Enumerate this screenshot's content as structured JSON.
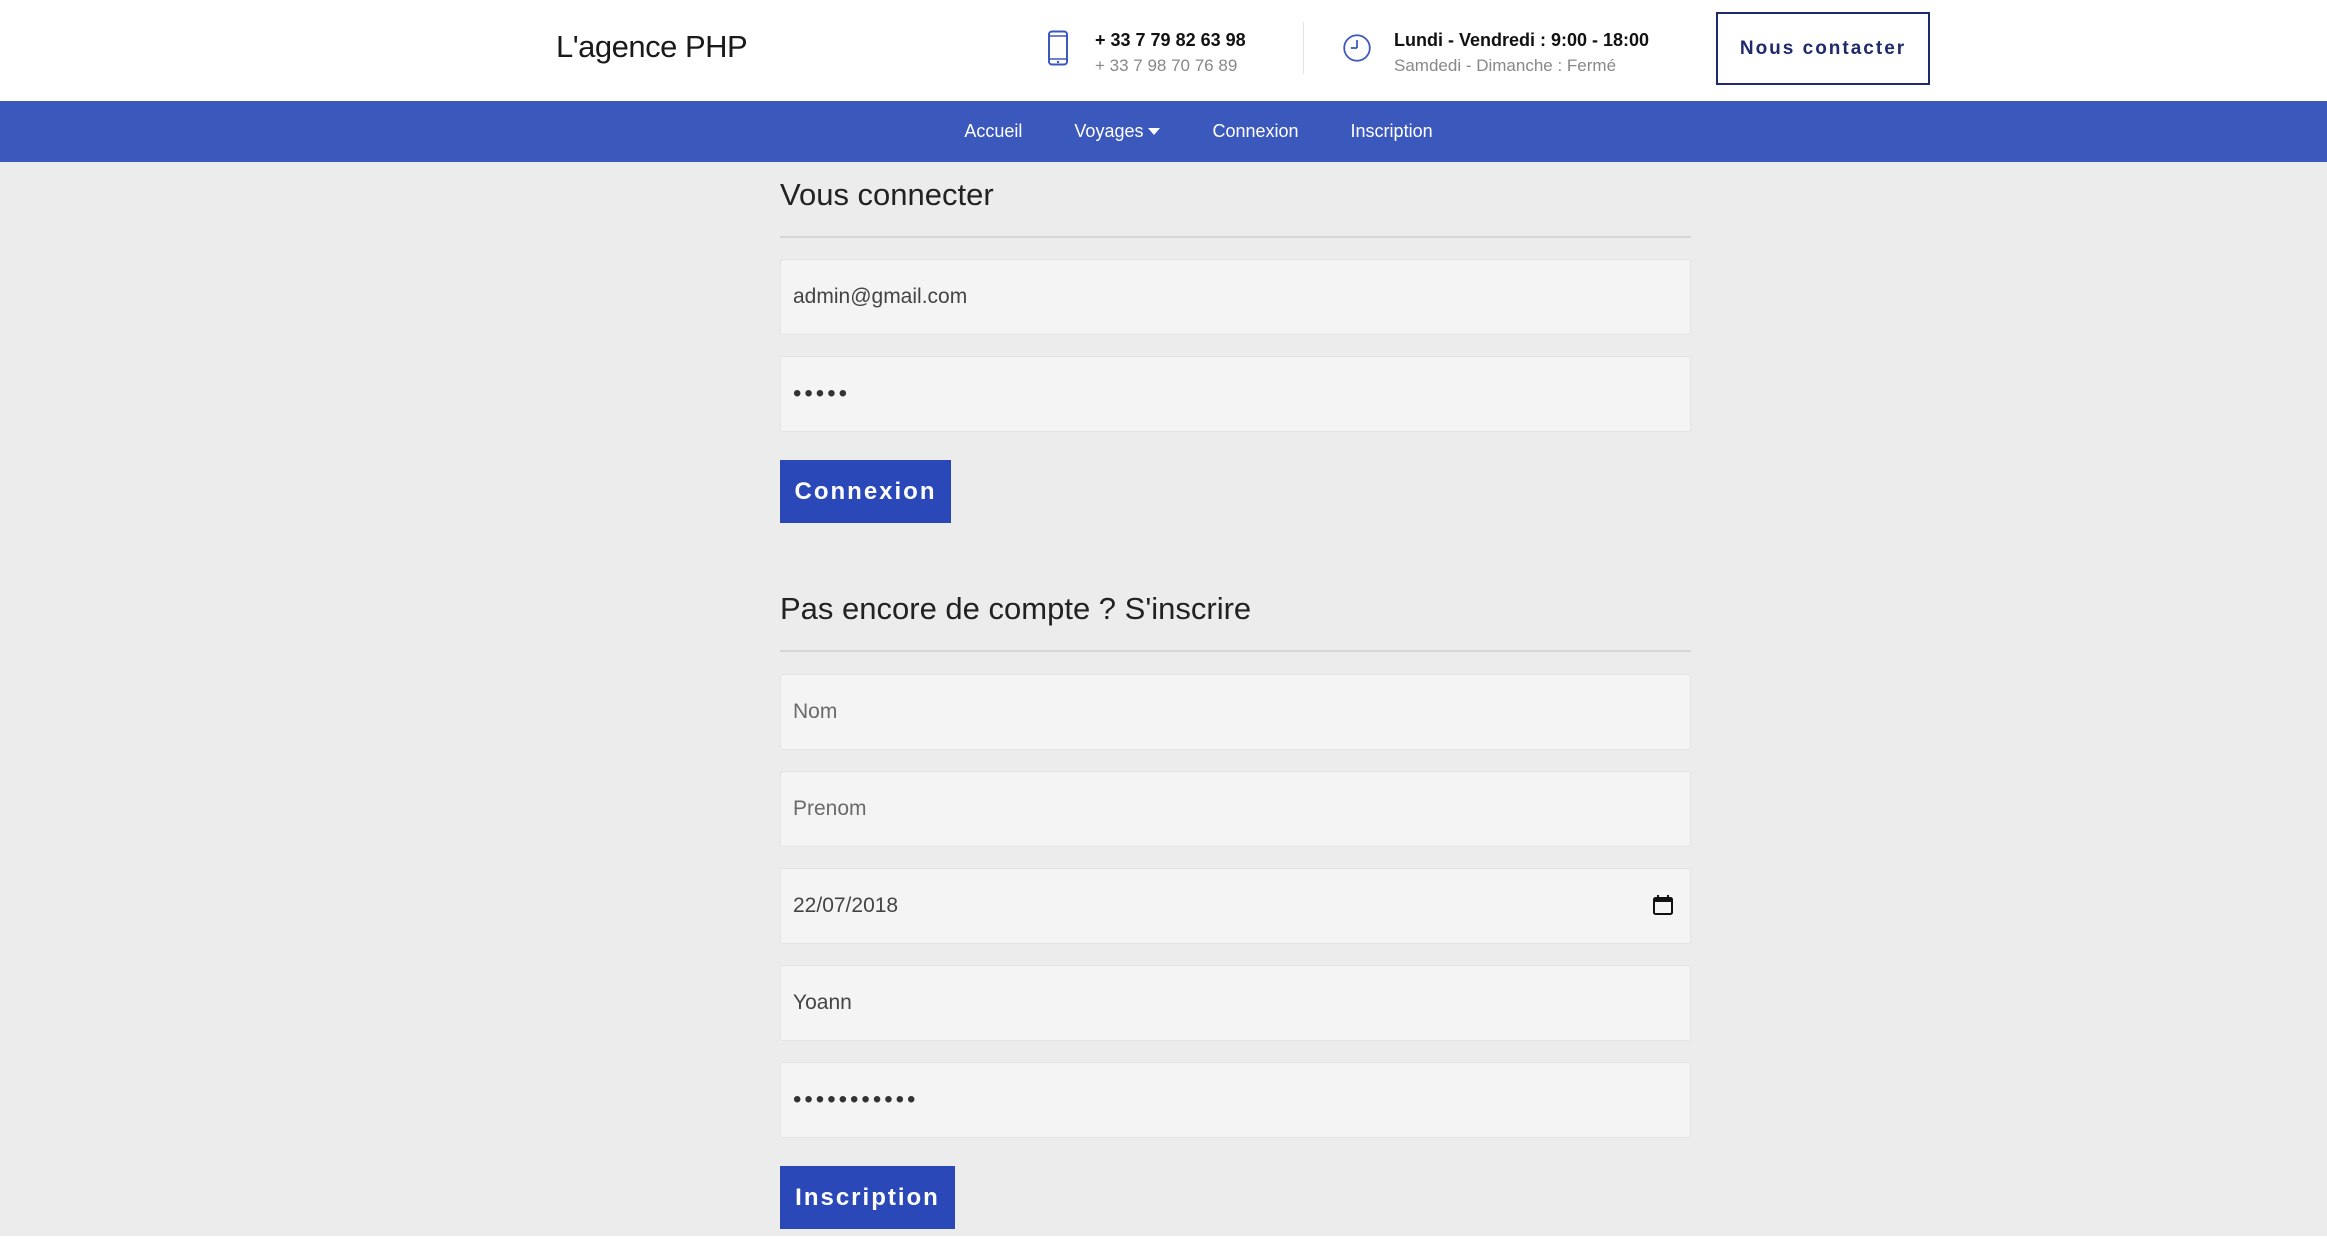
{
  "header": {
    "brand": "L'agence PHP",
    "phone": {
      "primary": "+ 33 7 79 82 63 98",
      "secondary": "+ 33 7 98 70 76 89",
      "icon": "phone-icon"
    },
    "hours": {
      "weekdays": "Lundi - Vendredi : 9:00 - 18:00",
      "weekend": "Samdedi - Dimanche : Fermé",
      "icon": "clock-icon"
    },
    "contact_button": "Nous contacter"
  },
  "nav": {
    "items": [
      {
        "label": "Accueil"
      },
      {
        "label": "Voyages"
      },
      {
        "label": "Connexion"
      },
      {
        "label": "Inscription"
      }
    ]
  },
  "login": {
    "title": "Vous connecter",
    "email_value": "admin@gmail.com",
    "password_mask": "•••••",
    "submit_label": "Connexion"
  },
  "signup": {
    "title": "Pas encore de compte ? S'inscrire",
    "nom_placeholder": "Nom",
    "prenom_placeholder": "Prenom",
    "birthdate_value": "22/07/2018",
    "username_value": "Yoann",
    "password_mask": "•••••••••••",
    "submit_label": "Inscription"
  },
  "colors": {
    "nav_bg": "#3b58bd",
    "button_bg": "#2a48b8",
    "contact_border": "#1f2a6b",
    "page_bg": "#ececec"
  }
}
